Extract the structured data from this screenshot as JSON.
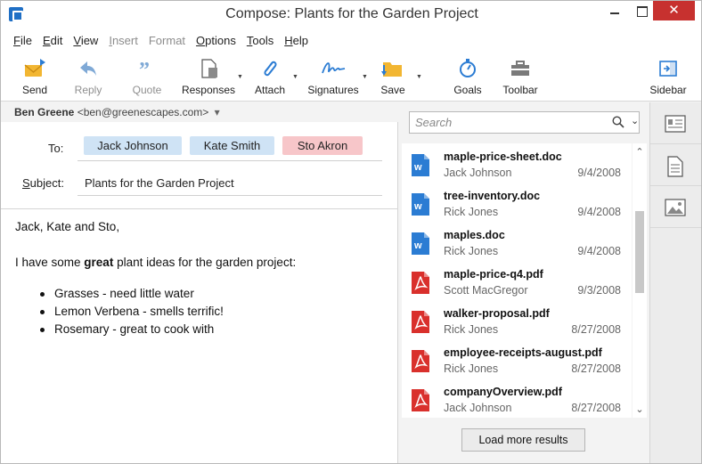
{
  "window": {
    "title": "Compose: Plants for the Garden Project",
    "close_glyph": "✕"
  },
  "menu": [
    {
      "label": "File",
      "u": "F",
      "rest": "ile",
      "disabled": false
    },
    {
      "label": "Edit",
      "u": "E",
      "rest": "dit",
      "disabled": false
    },
    {
      "label": "View",
      "u": "V",
      "rest": "iew",
      "disabled": false
    },
    {
      "label": "Insert",
      "u": "I",
      "rest": "nsert",
      "disabled": true
    },
    {
      "label": "Format",
      "u": "",
      "rest": "Format",
      "disabled": true
    },
    {
      "label": "Options",
      "u": "O",
      "rest": "ptions",
      "disabled": false
    },
    {
      "label": "Tools",
      "u": "T",
      "rest": "ools",
      "disabled": false
    },
    {
      "label": "Help",
      "u": "H",
      "rest": "elp",
      "disabled": false
    }
  ],
  "toolbar": {
    "send": "Send",
    "reply": "Reply",
    "quote": "Quote",
    "responses": "Responses",
    "attach": "Attach",
    "signatures": "Signatures",
    "save": "Save",
    "goals": "Goals",
    "toolbar": "Toolbar",
    "sidebar": "Sidebar"
  },
  "from": {
    "name": "Ben Greene",
    "email": "<ben@greenescapes.com>",
    "caret": "▾"
  },
  "to_label": "To:",
  "recipients": [
    {
      "name": "Jack Johnson",
      "color": "#cfe3f5"
    },
    {
      "name": "Kate Smith",
      "color": "#cfe3f5"
    },
    {
      "name": "Sto Akron",
      "color": "#f7c6c9"
    }
  ],
  "subject_label_u": "S",
  "subject_label_rest": "ubject:",
  "subject": "Plants for the Garden Project",
  "body": {
    "greeting": "Jack, Kate and Sto,",
    "intro_before": "I have some ",
    "intro_bold": "great",
    "intro_after": " plant ideas for the garden project:",
    "bullets": [
      "Grasses - need little water",
      "Lemon Verbena - smells terrific!",
      "Rosemary - great to cook with"
    ]
  },
  "search": {
    "placeholder": "Search",
    "drop_glyph": "⌄"
  },
  "results": [
    {
      "name": "maple-price-sheet.doc",
      "author": "Jack Johnson",
      "date": "9/4/2008",
      "type": "doc"
    },
    {
      "name": "tree-inventory.doc",
      "author": "Rick Jones",
      "date": "9/4/2008",
      "type": "doc"
    },
    {
      "name": "maples.doc",
      "author": "Rick Jones",
      "date": "9/4/2008",
      "type": "doc"
    },
    {
      "name": "maple-price-q4.pdf",
      "author": "Scott MacGregor",
      "date": "9/3/2008",
      "type": "pdf"
    },
    {
      "name": "walker-proposal.pdf",
      "author": "Rick Jones",
      "date": "8/27/2008",
      "type": "pdf"
    },
    {
      "name": "employee-receipts-august.pdf",
      "author": "Rick Jones",
      "date": "8/27/2008",
      "type": "pdf"
    },
    {
      "name": "companyOverview.pdf",
      "author": "Jack Johnson",
      "date": "8/27/2008",
      "type": "pdf"
    }
  ],
  "load_more": "Load more results",
  "colors": {
    "doc": "#2b7cd3",
    "pdf": "#d9302c",
    "accent": "#1f6fc5",
    "close": "#c7312f"
  }
}
